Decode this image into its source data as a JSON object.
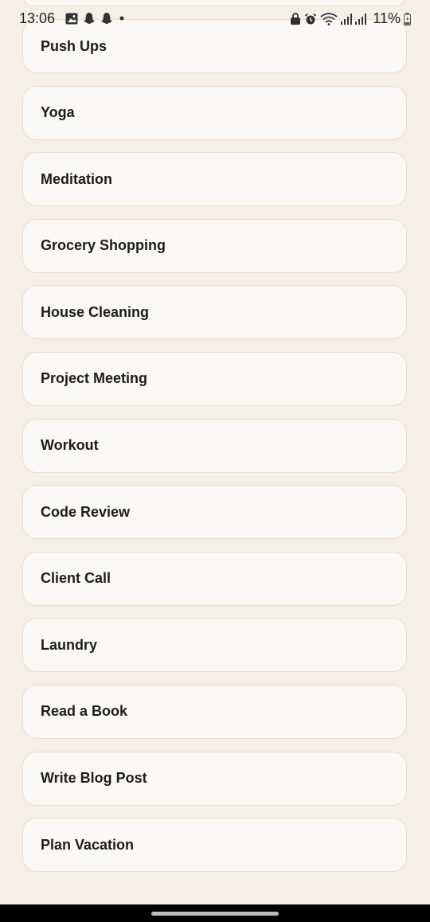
{
  "status_bar": {
    "time": "13:06",
    "battery_percent": "11%",
    "left_icons": [
      "gallery-icon",
      "snapchat-icon",
      "snapchat-icon",
      "dot-icon"
    ],
    "right_icons": [
      "lock-icon",
      "alarm-icon",
      "wifi-icon",
      "signal-icon",
      "signal-icon",
      "battery-charging-icon"
    ]
  },
  "tasks": [
    {
      "label": "Push Ups"
    },
    {
      "label": "Yoga"
    },
    {
      "label": "Meditation"
    },
    {
      "label": "Grocery Shopping"
    },
    {
      "label": "House Cleaning"
    },
    {
      "label": "Project Meeting"
    },
    {
      "label": "Workout"
    },
    {
      "label": "Code Review"
    },
    {
      "label": "Client Call"
    },
    {
      "label": "Laundry"
    },
    {
      "label": "Read a Book"
    },
    {
      "label": "Write Blog Post"
    },
    {
      "label": "Plan Vacation"
    }
  ],
  "colors": {
    "background": "#f5efe9",
    "card": "#faf8f6",
    "card_border": "#ecdcc9",
    "text": "#1c1c1c"
  }
}
